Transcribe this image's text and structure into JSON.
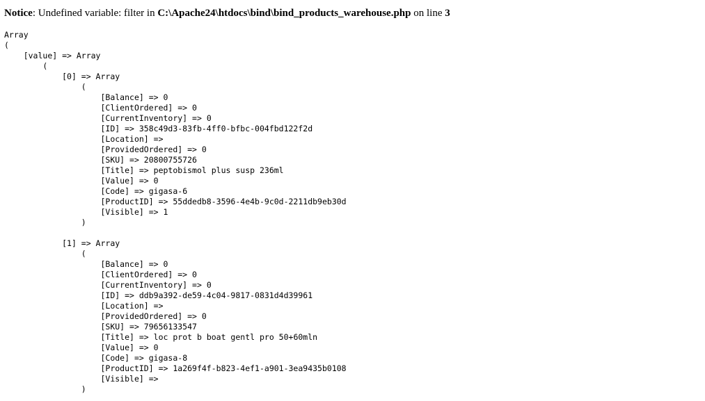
{
  "notice": {
    "label": "Notice",
    "sep": ": ",
    "message": "Undefined variable: filter in ",
    "file": "C:\\Apache24\\htdocs\\bind\\bind_products_warehouse.php",
    "on_line_text": " on line ",
    "line_number": "3"
  },
  "dump": {
    "root": {
      "type": "Array",
      "open": "(",
      "value_key": "[value] => Array",
      "value_open": "(",
      "items": [
        {
          "index_label": "[0] => Array",
          "open": "(",
          "fields": [
            {
              "key": "[Balance] => ",
              "value": "0"
            },
            {
              "key": "[ClientOrdered] => ",
              "value": "0"
            },
            {
              "key": "[CurrentInventory] => ",
              "value": "0"
            },
            {
              "key": "[ID] => ",
              "value": "358c49d3-83fb-4ff0-bfbc-004fbd122f2d"
            },
            {
              "key": "[Location] => ",
              "value": ""
            },
            {
              "key": "[ProvidedOrdered] => ",
              "value": "0"
            },
            {
              "key": "[SKU] => ",
              "value": "20800755726"
            },
            {
              "key": "[Title] => ",
              "value": "peptobismol plus susp 236ml"
            },
            {
              "key": "[Value] => ",
              "value": "0"
            },
            {
              "key": "[Code] => ",
              "value": "gigasa-6"
            },
            {
              "key": "[ProductID] => ",
              "value": "55ddedb8-3596-4e4b-9c0d-2211db9eb30d"
            },
            {
              "key": "[Visible] => ",
              "value": "1"
            }
          ],
          "close": ")"
        },
        {
          "index_label": "[1] => Array",
          "open": "(",
          "fields": [
            {
              "key": "[Balance] => ",
              "value": "0"
            },
            {
              "key": "[ClientOrdered] => ",
              "value": "0"
            },
            {
              "key": "[CurrentInventory] => ",
              "value": "0"
            },
            {
              "key": "[ID] => ",
              "value": "ddb9a392-de59-4c04-9817-0831d4d39961"
            },
            {
              "key": "[Location] => ",
              "value": ""
            },
            {
              "key": "[ProvidedOrdered] => ",
              "value": "0"
            },
            {
              "key": "[SKU] => ",
              "value": "79656133547"
            },
            {
              "key": "[Title] => ",
              "value": "loc prot b boat gentl pro 50+60mln"
            },
            {
              "key": "[Value] => ",
              "value": "0"
            },
            {
              "key": "[Code] => ",
              "value": "gigasa-8"
            },
            {
              "key": "[ProductID] => ",
              "value": "1a269f4f-b823-4ef1-a901-3ea9435b0108"
            },
            {
              "key": "[Visible] => ",
              "value": ""
            }
          ],
          "close": ")"
        }
      ]
    }
  }
}
